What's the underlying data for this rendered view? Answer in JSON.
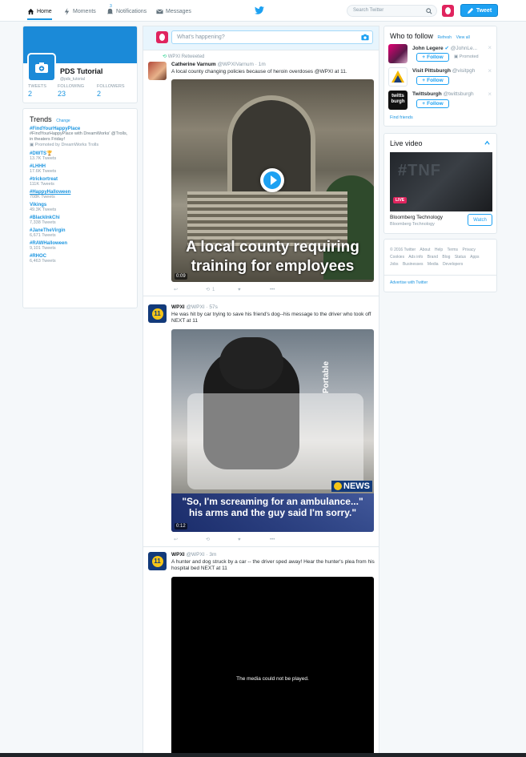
{
  "nav": {
    "home": "Home",
    "moments": "Moments",
    "notifications": "Notifications",
    "notifications_badge": "3",
    "messages": "Messages",
    "search_placeholder": "Search Twitter",
    "tweet_button": "Tweet"
  },
  "profile": {
    "name": "PDS Tutorial",
    "handle": "@pds_tutorial",
    "tweets_label": "TWEETS",
    "tweets_value": "2",
    "following_label": "FOLLOWING",
    "following_value": "23",
    "followers_label": "FOLLOWERS",
    "followers_value": "2"
  },
  "trends": {
    "title": "Trends",
    "change": "Change",
    "items": [
      {
        "tag": "#FindYourHappyPlace",
        "desc": "#FindYourHappyPlace with DreamWorks' @Trolls, in theaters Friday!",
        "promoted": "Promoted by DreamWorks Trolls"
      },
      {
        "tag": "#DWTS🏆",
        "count": "13.7K Tweets"
      },
      {
        "tag": "#LHHH",
        "count": "17.6K Tweets"
      },
      {
        "tag": "#trickortreat",
        "count": "111K Tweets"
      },
      {
        "tag": "#HappyHalloween",
        "count": "708K Tweets"
      },
      {
        "tag": "Vikings",
        "count": "49.3K Tweets"
      },
      {
        "tag": "#BlackInkChi",
        "count": "7,338 Tweets"
      },
      {
        "tag": "#JaneTheVirgin",
        "count": "6,671 Tweets"
      },
      {
        "tag": "#RAWHalloween",
        "count": "9,101 Tweets"
      },
      {
        "tag": "#RHOC",
        "count": "6,463 Tweets"
      }
    ]
  },
  "composer": {
    "placeholder": "What's happening?"
  },
  "tweets": [
    {
      "retweet_by": "WPXI Retweeted",
      "name": "Catherine Varnum",
      "handle": "@WPXIVarnum · 1m",
      "text": "A local county changing policies because of heroin overdoses @WPXI at 11.",
      "caption": "A local county requiring training for employees",
      "duration": "0:09",
      "retweets": "1"
    },
    {
      "name": "WPXI",
      "handle": "@WPXI · 57s",
      "text": "He was hit by car trying to save his friend's dog--his message to the driver who took off NEXT at 11",
      "overlay_text": "Portable",
      "logo_text": "NEWS",
      "quote": "\"So, I'm screaming for an ambulance...\" his arms and the guy said I'm sorry.\"",
      "duration": "0:12"
    },
    {
      "name": "WPXI",
      "handle": "@WPXI · 3m",
      "text": "A hunter and dog struck by a car -- the driver sped away! Hear the hunter's plea from his hospital bed NEXT at 11",
      "media_message": "The media could not be played."
    }
  ],
  "who_to_follow": {
    "title": "Who to follow",
    "refresh": "Refresh",
    "view_all": "View all",
    "follow_label": "Follow",
    "items": [
      {
        "name": "John Legere",
        "handle": "@JohnLe...",
        "promoted": "Promoted"
      },
      {
        "name": "Visit Pittsburgh",
        "handle": "@visitpgh"
      },
      {
        "name": "Twittsburgh",
        "handle": "@twittsburgh",
        "avatar_text": "twitts burgh"
      }
    ],
    "find_friends": "Find friends"
  },
  "live_video": {
    "title": "Live video",
    "video_text": "#TNF",
    "live_badge": "LIVE",
    "channel": "Bloomberg Technology",
    "sub": "Bloomberg Technology",
    "watch": "Watch"
  },
  "footer": {
    "links": [
      "© 2016 Twitter",
      "About",
      "Help",
      "Terms",
      "Privacy",
      "Cookies",
      "Ads info",
      "Brand",
      "Blog",
      "Status",
      "Apps",
      "Jobs",
      "Businesses",
      "Media",
      "Developers"
    ],
    "advertise": "Advertise with Twitter"
  },
  "colors": {
    "brand_blue": "#1da1f2",
    "banner_blue": "#1b8ad8",
    "link_blue": "#1b95e0"
  }
}
